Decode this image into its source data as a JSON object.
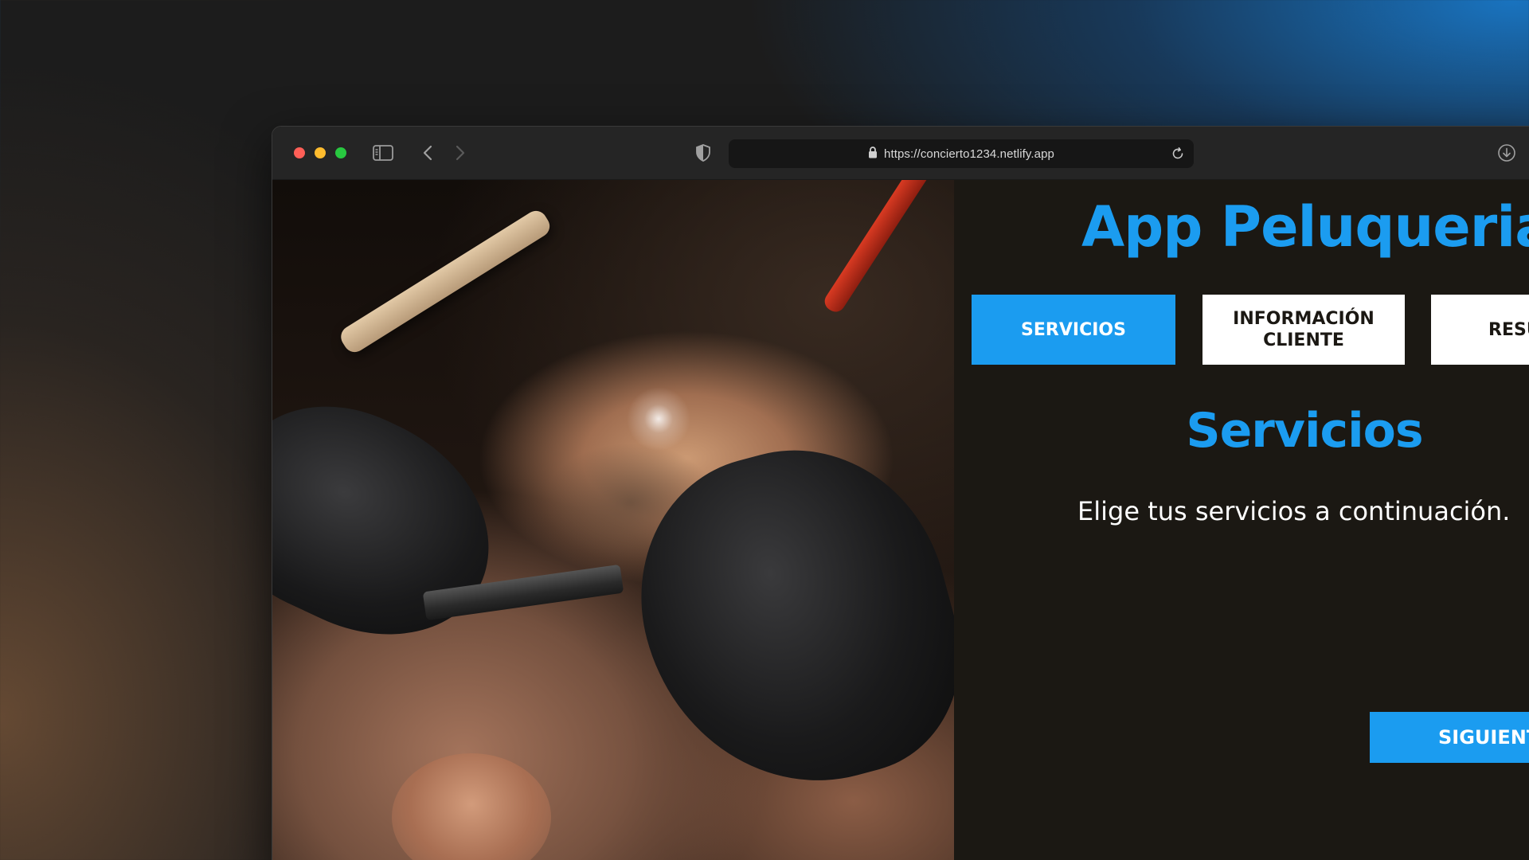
{
  "browser": {
    "url": "https://concierto1234.netlify.app",
    "icons": {
      "sidebar_toggle": "sidebar-icon",
      "back": "chevron-left-icon",
      "forward": "chevron-right-icon",
      "shield": "shield-icon",
      "lock": "lock-icon",
      "reload": "reload-icon",
      "download": "download-icon"
    }
  },
  "page": {
    "app_title": "App Peluqueria",
    "tabs": [
      {
        "label": "SERVICIOS",
        "active": true
      },
      {
        "label": "INFORMACIÓN CLIENTE",
        "line1": "INFORMACIÓN",
        "line2": "CLIENTE",
        "active": false
      },
      {
        "label": "RESU",
        "active": false
      }
    ],
    "section": {
      "title": "Servicios",
      "description": "Elige tus servicios a continuación."
    },
    "next_button": "SIGUIENT"
  },
  "colors": {
    "accent": "#1b9cf0",
    "page_background": "#1b1813",
    "toolbar": "#252525"
  }
}
